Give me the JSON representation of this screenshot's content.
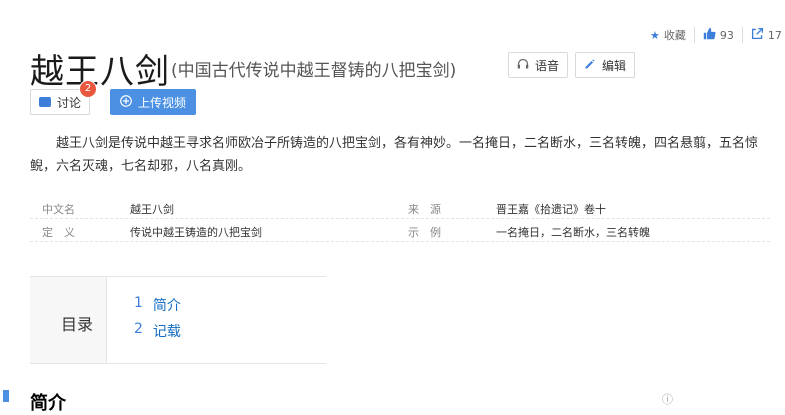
{
  "top_actions": {
    "collect_label": "收藏",
    "like_count": "93",
    "share_count": "17",
    "accent": "#3d7edb"
  },
  "header": {
    "title": "越王八剑",
    "subtitle": "(中国古代传说中越王督铸的八把宝剑)",
    "voice_label": "语音",
    "edit_label": "编辑",
    "discuss_label": "讨论",
    "discuss_badge": "2",
    "upload_label": "上传视频"
  },
  "summary": "越王八剑是传说中越王寻求名师欧冶子所铸造的八把宝剑，各有神妙。一名掩日，二名断水，三名转魄，四名悬翦，五名惊鲵，六名灭魂，七名却邪，八名真刚。",
  "basic_info": [
    {
      "label": "中文名",
      "value": "越王八剑"
    },
    {
      "label": "来　源",
      "value": "晋王嘉《拾遗记》卷十"
    },
    {
      "label": "定　义",
      "value": "传说中越王铸造的八把宝剑"
    },
    {
      "label": "示　例",
      "value": "一名掩日，二名断水，三名转魄"
    }
  ],
  "toc": {
    "heading": "目录",
    "items": [
      {
        "num": "1",
        "label": "简介"
      },
      {
        "num": "2",
        "label": "记载"
      }
    ]
  },
  "section_heading": "简介"
}
